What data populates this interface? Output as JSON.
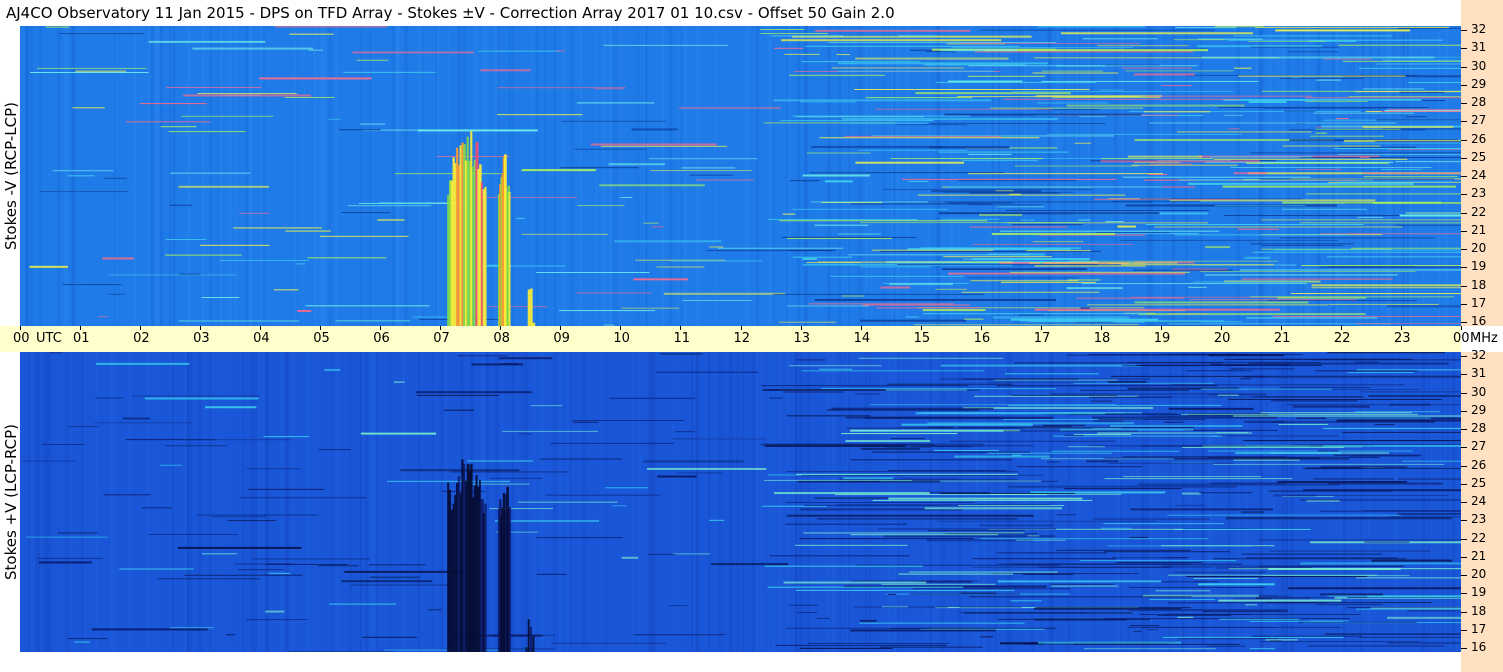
{
  "title": "AJ4CO Observatory  11 Jan 2015  -  DPS on TFD Array  -  Stokes ±V  -  Correction Array 2017 01 10.csv  -  Offset 50  Gain 2.0",
  "colors": {
    "background_top": "#1f7be8",
    "background_bottom": "#1a57d8",
    "burst_hot": "#ffee33",
    "burst_warm": "#88dd44",
    "burst_bottom": "#050a30",
    "axis_band": "#ffffcc",
    "freq_band": "#ffe0c0"
  },
  "time_axis": {
    "labels": [
      "00",
      "01",
      "02",
      "03",
      "04",
      "05",
      "06",
      "07",
      "08",
      "09",
      "10",
      "11",
      "12",
      "13",
      "14",
      "15",
      "16",
      "17",
      "18",
      "19",
      "20",
      "21",
      "22",
      "23",
      "00"
    ],
    "utc_label": "UTC",
    "mhz_label": "MHz"
  },
  "chart_data": [
    {
      "type": "heatmap",
      "name": "Stokes -V (RCP-LCP)",
      "ylabel": "Stokes -V (RCP-LCP)",
      "xlabel": "UTC",
      "x_range_hours": [
        0,
        24
      ],
      "y_range_mhz": [
        16,
        32
      ],
      "y_ticks": [
        32,
        31,
        30,
        29,
        28,
        27,
        26,
        25,
        24,
        23,
        22,
        21,
        20,
        19,
        18,
        17,
        16
      ],
      "bursts": [
        {
          "start_hour": 7.1,
          "end_hour": 7.75,
          "min_mhz": 16,
          "max_mhz": 26.8,
          "intensity": "high"
        },
        {
          "start_hour": 7.95,
          "end_hour": 8.15,
          "min_mhz": 16,
          "max_mhz": 25.4,
          "intensity": "medium"
        },
        {
          "start_hour": 8.4,
          "end_hour": 8.55,
          "min_mhz": 16,
          "max_mhz": 18.5,
          "intensity": "low"
        }
      ]
    },
    {
      "type": "heatmap",
      "name": "Stokes +V (LCP-RCP)",
      "ylabel": "Stokes +V (LCP-RCP)",
      "xlabel": "UTC",
      "x_range_hours": [
        0,
        24
      ],
      "y_range_mhz": [
        16,
        32
      ],
      "y_ticks": [
        32,
        31,
        30,
        29,
        28,
        27,
        26,
        25,
        24,
        23,
        22,
        21,
        20,
        19,
        18,
        17,
        16
      ],
      "bursts": [
        {
          "start_hour": 7.1,
          "end_hour": 7.75,
          "min_mhz": 16,
          "max_mhz": 26.8,
          "intensity": "high"
        },
        {
          "start_hour": 7.95,
          "end_hour": 8.15,
          "min_mhz": 16,
          "max_mhz": 25.4,
          "intensity": "medium"
        },
        {
          "start_hour": 8.4,
          "end_hour": 8.55,
          "min_mhz": 16,
          "max_mhz": 18.5,
          "intensity": "low"
        }
      ]
    }
  ]
}
